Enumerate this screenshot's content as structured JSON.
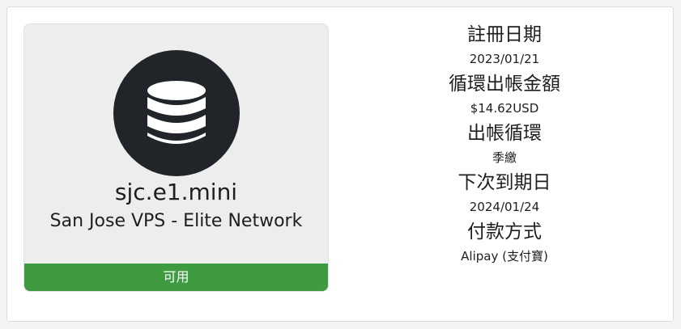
{
  "product": {
    "icon": "database-icon",
    "name": "sjc.e1.mini",
    "group": "San Jose VPS - Elite Network",
    "status": "可用",
    "status_color": "#3e9b40"
  },
  "details": [
    {
      "label": "註冊日期",
      "value": "2023/01/21"
    },
    {
      "label": "循環出帳金額",
      "value": "$14.62USD"
    },
    {
      "label": "出帳循環",
      "value": "季繳"
    },
    {
      "label": "下次到期日",
      "value": "2024/01/24"
    },
    {
      "label": "付款方式",
      "value": "Alipay (支付寶)"
    }
  ]
}
